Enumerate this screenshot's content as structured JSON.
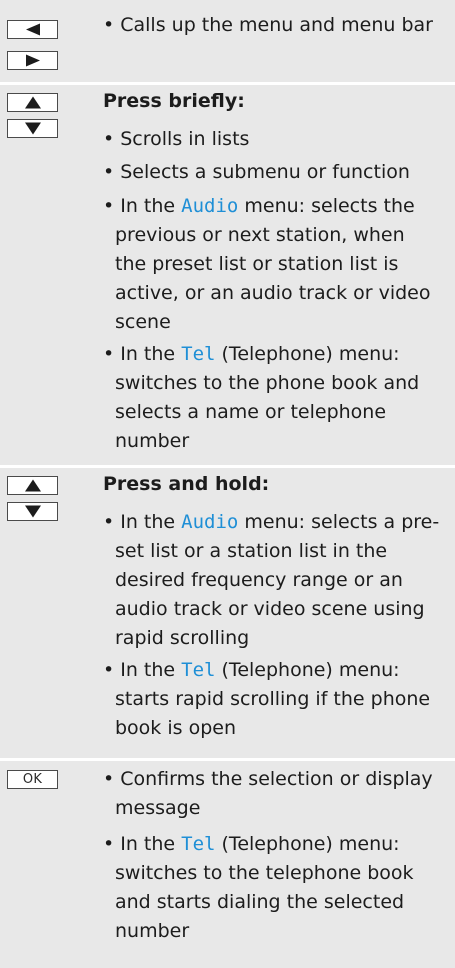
{
  "rows": {
    "r1": {
      "bullets": [
        "• Calls up the menu and menu bar"
      ]
    },
    "r2": {
      "heading": "Press briefly:",
      "b1": "• Scrolls in lists",
      "b2": "• Selects a submenu or function",
      "b3": {
        "pre": "• In the ",
        "hl": "Audio",
        "l1rest": " menu: selects the",
        "l2": "previous or next station, when",
        "l3": "the preset list or station list is",
        "l4": "active, or an audio track or video",
        "l5": "scene"
      },
      "b4": {
        "pre": "• In the ",
        "hl": "Tel",
        "l1rest": " (Telephone) menu:",
        "l2": "switches to the phone book and",
        "l3": "selects a name or telephone",
        "l4": "number"
      }
    },
    "r3": {
      "heading": "Press and hold:",
      "b1": {
        "pre": "• In the ",
        "hl": "Audio",
        "l1rest": " menu: selects a pre-",
        "l2": "set list or a station list in the",
        "l3": "desired frequency range or an",
        "l4": "audio track or video scene using",
        "l5": "rapid scrolling"
      },
      "b2": {
        "pre": "• In the ",
        "hl": "Tel",
        "l1rest": " (Telephone) menu:",
        "l2": "starts rapid scrolling if the phone",
        "l3": "book is open"
      }
    },
    "r4": {
      "key_label": "OK",
      "b1": {
        "l1": "• Confirms the selection or display",
        "l2": "message"
      },
      "b2": {
        "pre": "• In the ",
        "hl": "Tel",
        "l1rest": " (Telephone) menu:",
        "l2": "switches to the telephone book",
        "l3": "and starts dialing the selected",
        "l4": "number"
      }
    }
  },
  "colors": {
    "row_bg": "#e8e8e8",
    "highlight": "#1f8fd6",
    "key_border": "#4a4a4a"
  },
  "icons": [
    "left-arrow-key-icon",
    "right-arrow-key-icon",
    "up-arrow-key-icon",
    "down-arrow-key-icon",
    "ok-key-icon"
  ]
}
